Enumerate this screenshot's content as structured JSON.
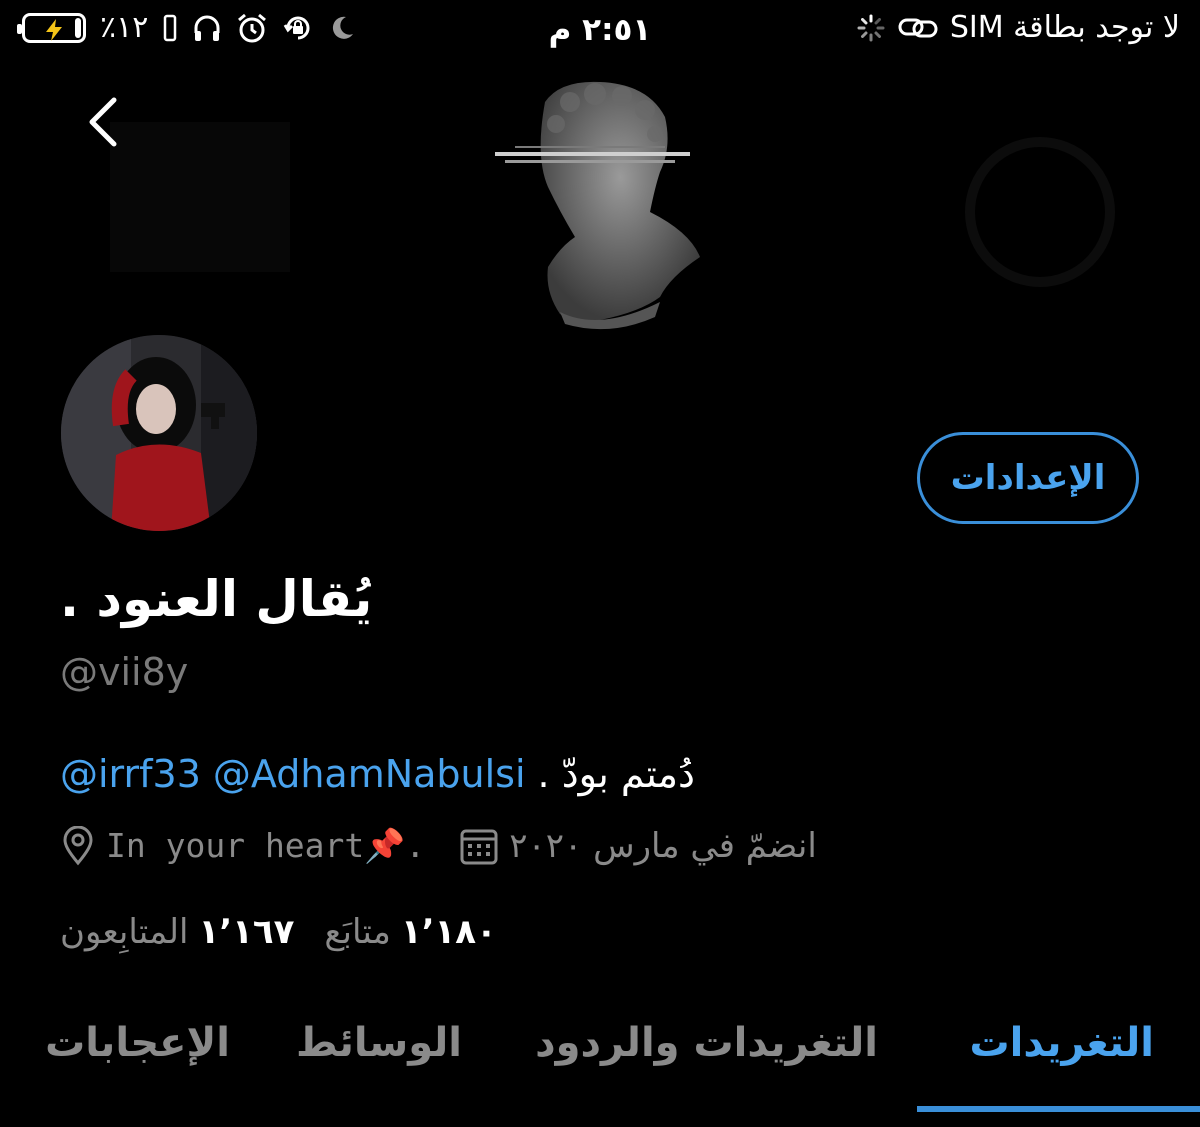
{
  "status_bar": {
    "carrier": "لا توجد بطاقة SIM",
    "time": "٢:٥١ م",
    "battery_percent": "٪١٢",
    "battery_level": 0.12
  },
  "header": {
    "back_icon": "chevron-left-icon"
  },
  "profile": {
    "settings_label": "الإعدادات",
    "display_name": "يُقال العنود .",
    "handle": "@vii8y",
    "bio_text": "دُمتم بودّ .",
    "bio_mentions": [
      "@AdhamNabulsi",
      "@irrf33"
    ],
    "location": "In your heart📌.",
    "joined": "انضمّ في مارس ٢٠٢٠",
    "following_count": "١٬١٨٠",
    "following_label": "متابَع",
    "followers_count": "١٬١٦٧",
    "followers_label": "المتابِعون"
  },
  "tabs": [
    {
      "label": "التغريدات",
      "active": true
    },
    {
      "label": "التغريدات والردود",
      "active": false
    },
    {
      "label": "الوسائط",
      "active": false
    },
    {
      "label": "الإعجابات",
      "active": false
    }
  ],
  "colors": {
    "accent": "#4aa3ee",
    "background": "#000000",
    "muted_text": "#8a8a8a"
  }
}
